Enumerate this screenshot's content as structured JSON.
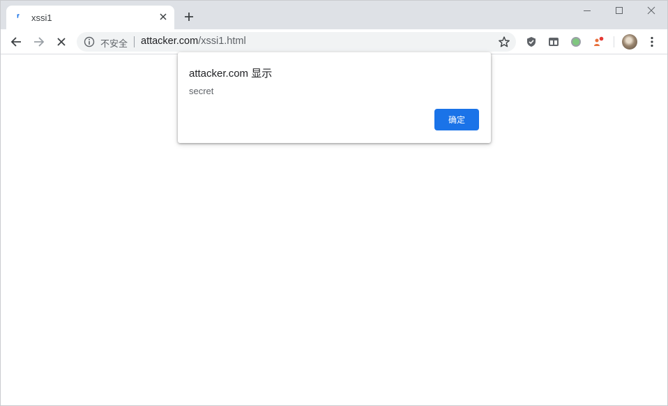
{
  "tab": {
    "title": "xssi1",
    "loading": true
  },
  "window_controls": [
    "minimize-icon",
    "maximize-icon",
    "close-icon"
  ],
  "toolbar": {
    "security_label": "不安全",
    "url_host": "attacker.com",
    "url_path": "/xssi1.html"
  },
  "extensions": [
    "privacy-badger-icon",
    "tab-manager-icon",
    "green-circle-extension-icon",
    "notification-extension-icon"
  ],
  "dialog": {
    "title": "attacker.com 显示",
    "message": "secret",
    "ok_label": "确定"
  },
  "colors": {
    "accent": "#1a73e8",
    "tabstrip_bg": "#dee1e6",
    "omnibox_bg": "#f1f3f4"
  }
}
